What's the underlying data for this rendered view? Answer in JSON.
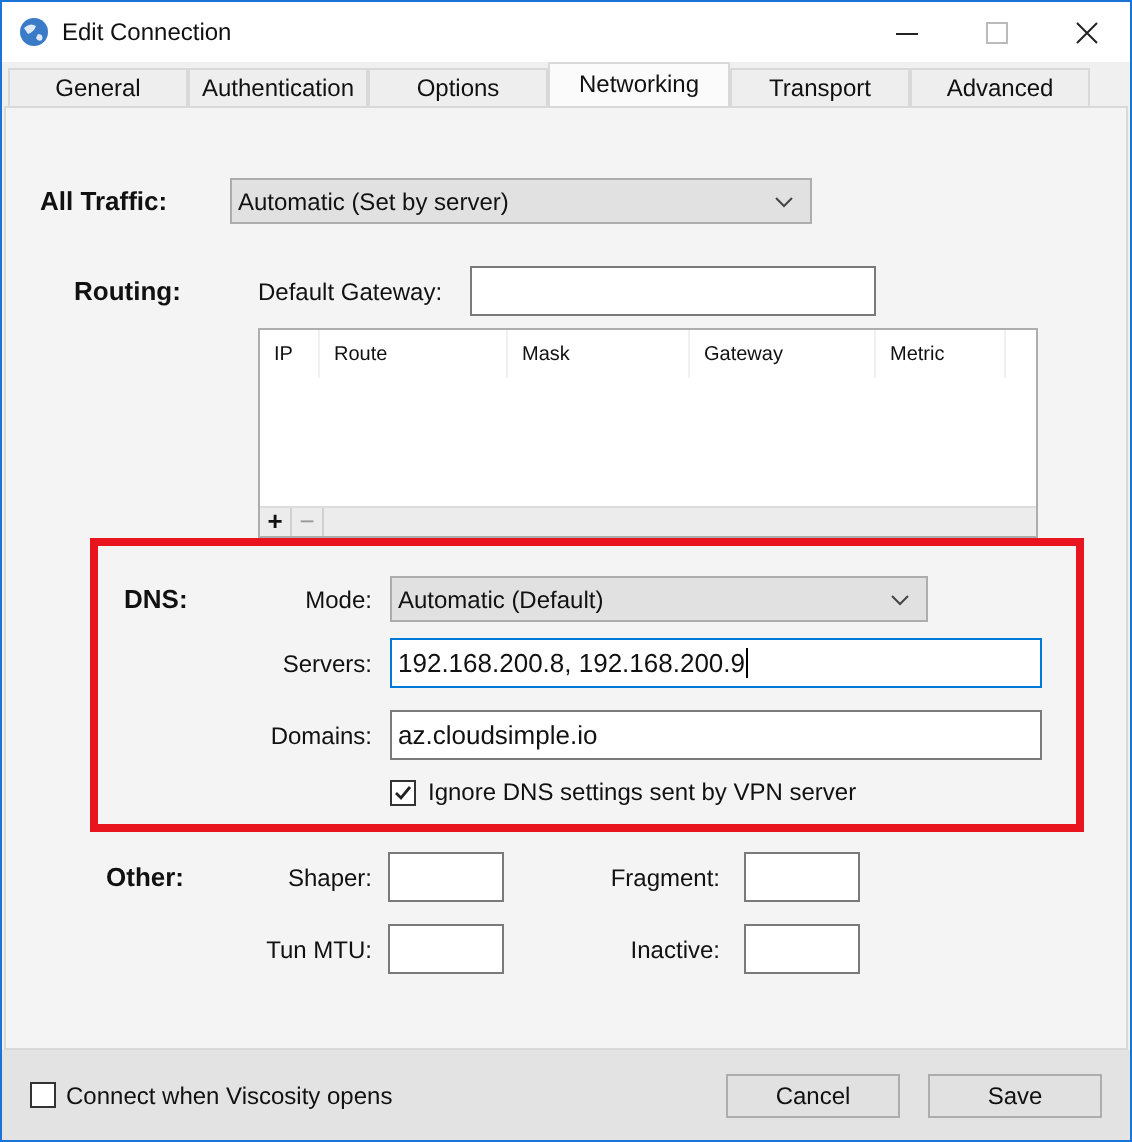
{
  "window": {
    "title": "Edit Connection"
  },
  "tabs": [
    {
      "label": "General",
      "selected": false
    },
    {
      "label": "Authentication",
      "selected": false
    },
    {
      "label": "Options",
      "selected": false
    },
    {
      "label": "Networking",
      "selected": true
    },
    {
      "label": "Transport",
      "selected": false
    },
    {
      "label": "Advanced",
      "selected": false
    }
  ],
  "all_traffic": {
    "label": "All Traffic:",
    "value": "Automatic (Set by server)"
  },
  "routing": {
    "label": "Routing:",
    "gateway_label": "Default Gateway:",
    "table": {
      "columns": [
        "IP",
        "Route",
        "Mask",
        "Gateway",
        "Metric"
      ]
    },
    "add": "+",
    "remove": "−"
  },
  "dns": {
    "highlighted": true,
    "label": "DNS:",
    "mode_label": "Mode:",
    "mode": "Automatic (Default)",
    "servers_label": "Servers:",
    "servers": "192.168.200.8, 192.168.200.9",
    "servers_focused": true,
    "domains_label": "Domains:",
    "domains": "az.cloudsimple.io",
    "ignore": {
      "label": "Ignore DNS settings sent by VPN server",
      "checked": true
    }
  },
  "other": {
    "label": "Other:",
    "fields": [
      {
        "label": "Shaper:"
      },
      {
        "label": "Fragment:"
      },
      {
        "label": "Tun MTU:"
      },
      {
        "label": "Inactive:"
      }
    ]
  },
  "footer": {
    "connect": {
      "label": "Connect when Viscosity opens",
      "checked": false
    },
    "buttons": [
      "Cancel",
      "Save"
    ]
  }
}
